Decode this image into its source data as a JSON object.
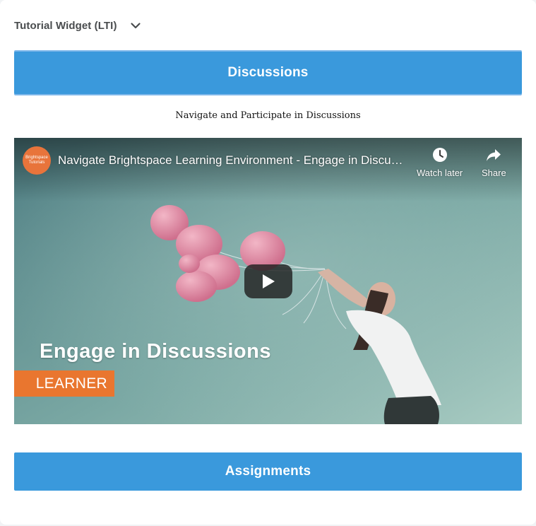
{
  "widget": {
    "title": "Tutorial Widget (LTI)",
    "dropdown_icon": "chevron-down-icon"
  },
  "sections": {
    "discussions_label": "Discussions",
    "assignments_label": "Assignments"
  },
  "video_section": {
    "subtitle": "Navigate and Participate in Discussions"
  },
  "video": {
    "channel_logo_text": "Brightspace Tutorials",
    "title": "Navigate Brightspace Learning Environment - Engage in Discussions",
    "watch_later_label": "Watch later",
    "share_label": "Share",
    "watch_later_icon": "clock-icon",
    "share_icon": "share-arrow-icon",
    "play_icon": "play-icon",
    "overlay_heading": "Engage in Discussions",
    "overlay_tag": "LEARNER"
  },
  "colors": {
    "section_button": "#3a99dc",
    "tag_orange": "#e9762f",
    "youtube_play": "#212121"
  }
}
